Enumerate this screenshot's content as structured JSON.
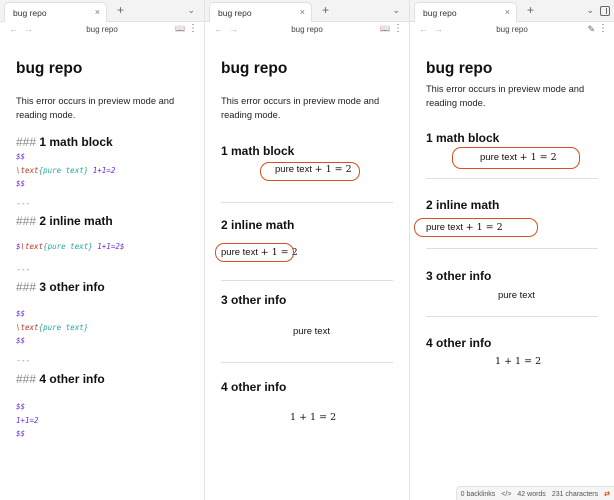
{
  "tab": {
    "title": "bug repo",
    "close_glyph": "×",
    "new_glyph": "+",
    "menu_glyph": "⌄"
  },
  "nav": {
    "back_glyph": "←",
    "forward_glyph": "→",
    "title": "bug repo",
    "book_glyph": "📖",
    "more_glyph": "⋮",
    "edit_glyph": "✎"
  },
  "note": {
    "title": "bug repo",
    "intro": "This error occurs in preview mode and reading mode."
  },
  "source_pane": {
    "headings": [
      {
        "marker": "###",
        "text": " 1 math block"
      },
      {
        "marker": "###",
        "text": " 2 inline math"
      },
      {
        "marker": "###",
        "text": " 3 other info"
      },
      {
        "marker": "###",
        "text": " 4 other info"
      }
    ],
    "hr_text": "---",
    "block1": {
      "open": "$$",
      "cmd": "\\text",
      "arg": "{pure text}",
      "tail": " 1+1=2",
      "close": "$$"
    },
    "block2": {
      "open": "$",
      "cmd": "\\text",
      "arg": "{pure text}",
      "tail": " 1+1=2$"
    },
    "block3": {
      "open": "$$",
      "cmd": "\\text",
      "arg": "{pure text}",
      "close": "$$"
    },
    "block4": {
      "open": "$$",
      "line": "1+1=2",
      "close": "$$"
    }
  },
  "rendered": {
    "headings": [
      "1 math block",
      "2 inline math",
      "3 other info",
      "4 other info"
    ],
    "math_text": "pure text",
    "math_expr": "+ 1 = 2",
    "plain_text": "pure text",
    "sum_expr": "1 + 1 = 2"
  },
  "status_bar": {
    "backlinks": "0 backlinks",
    "code_glyph": "</>",
    "words": "42 words",
    "characters": "231 characters",
    "sync_glyph": "⇄"
  },
  "colors": {
    "annotation_oval": "#d8501f",
    "latex_delimiter": "#6b2bd8",
    "latex_command": "#c0392b",
    "latex_arg": "#2aa7a0"
  }
}
